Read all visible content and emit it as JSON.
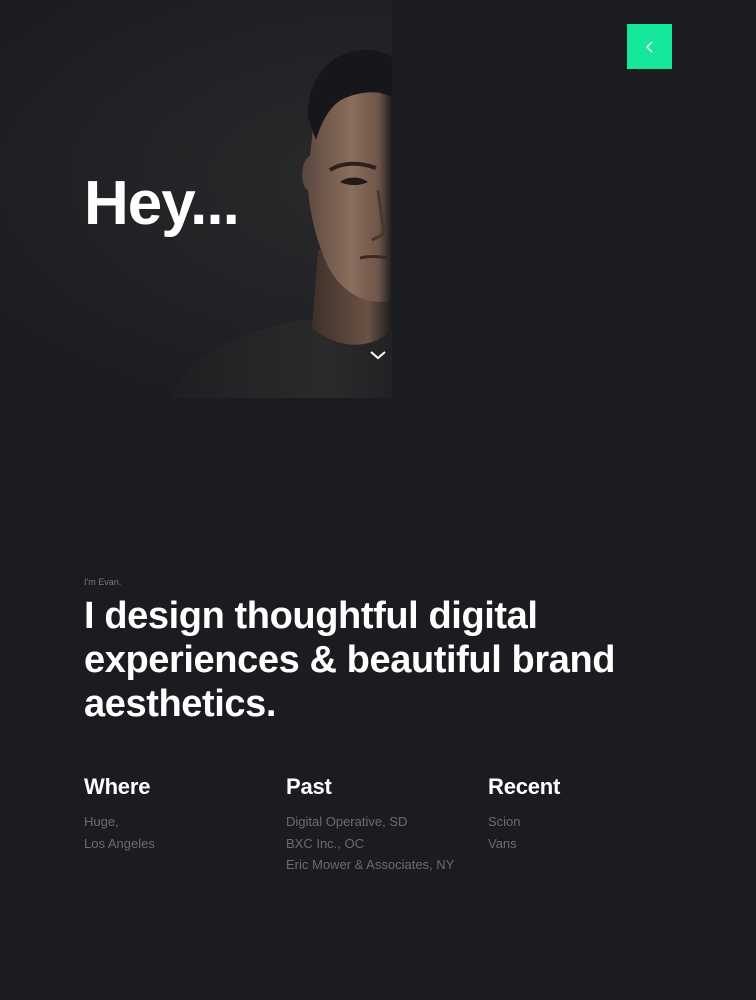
{
  "hero": {
    "title": "Hey...",
    "back_icon": "chevron-left-icon",
    "scroll_icon": "chevron-down-icon",
    "accent": "#16e89b"
  },
  "intro": {
    "eyebrow": "I'm Evan.",
    "headline_lines": [
      "I design thoughtful digital",
      "experiences & beautiful brand",
      "aesthetics."
    ]
  },
  "columns": {
    "where": {
      "title": "Where",
      "items": [
        "Huge,",
        "Los Angeles"
      ]
    },
    "past": {
      "title": "Past",
      "items": [
        "Digital Operative, SD",
        "BXC Inc., OC",
        "Eric Mower & Associates, NY"
      ]
    },
    "recent": {
      "title": "Recent",
      "items": [
        "Scion",
        "Vans"
      ]
    }
  }
}
